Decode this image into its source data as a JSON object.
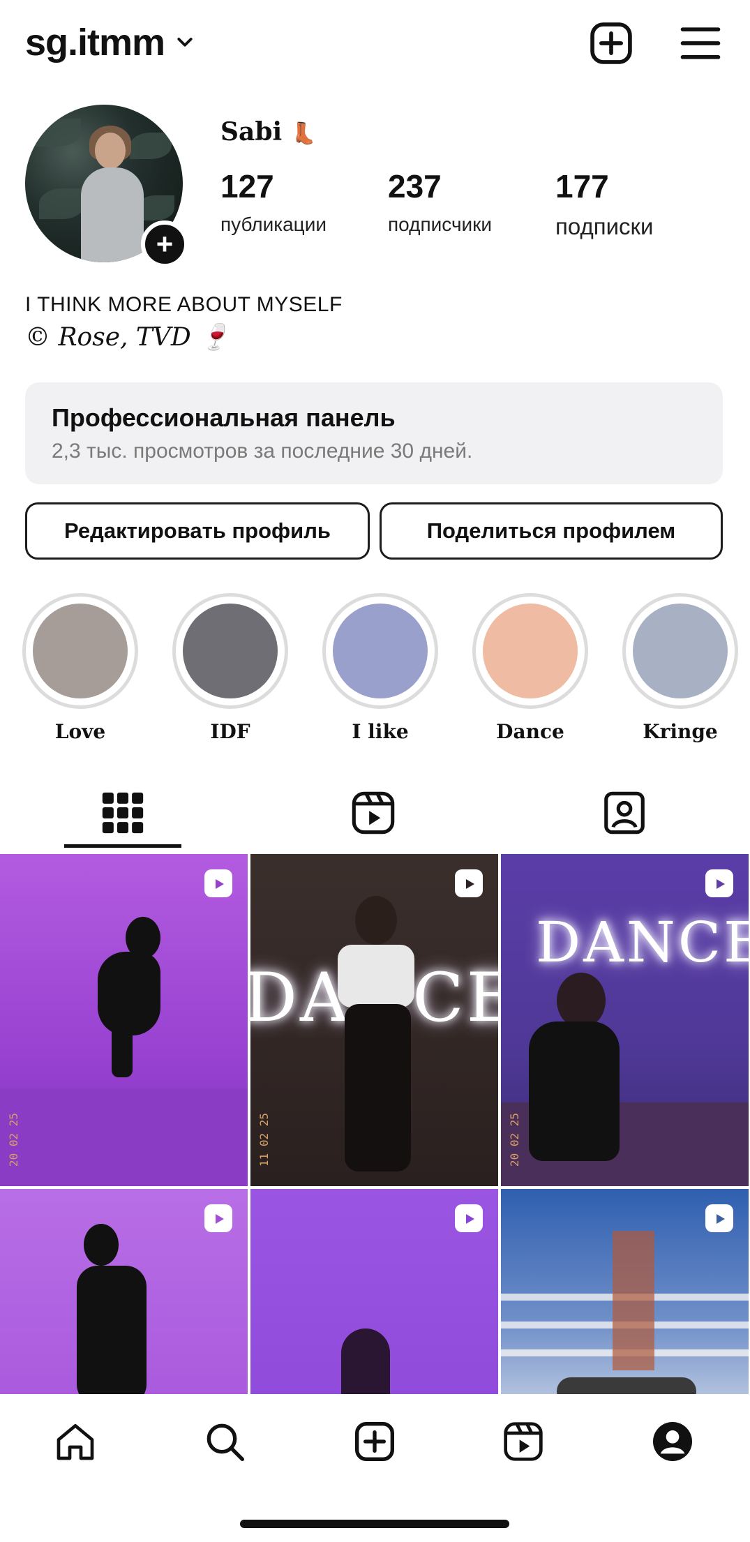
{
  "header": {
    "username": "sg.itmm",
    "icons": [
      "chevron-down-icon",
      "add-post-icon",
      "menu-icon"
    ]
  },
  "profile": {
    "display_name": "Sabi",
    "stats": [
      {
        "value": "127",
        "label": "публикации"
      },
      {
        "value": "237",
        "label": "подписчики"
      },
      {
        "value": "177",
        "label": "подписки"
      }
    ],
    "bio_line1": "I THINK MORE ABOUT MYSELF",
    "bio_line2": "© Rose, TVD 🍷"
  },
  "pro_panel": {
    "title": "Профессиональная панель",
    "subtitle": "2,3 тыс. просмотров за последние 30 дней."
  },
  "buttons": {
    "edit": "Редактировать профиль",
    "share": "Поделиться профилем"
  },
  "highlights": [
    {
      "label": "Love",
      "color": "#a69d98"
    },
    {
      "label": "IDF",
      "color": "#6e6e74"
    },
    {
      "label": "I like",
      "color": "#9aa0cc"
    },
    {
      "label": "Dance",
      "color": "#efbba3"
    },
    {
      "label": "Kringe",
      "color": "#a8b0c4"
    }
  ],
  "tabs": [
    "grid-icon",
    "reels-icon",
    "tagged-icon"
  ],
  "posts": [
    {
      "bg": "#9b46d4",
      "neon": "",
      "date": "20 02 25"
    },
    {
      "bg": "#2d2322",
      "neon": "DANCE",
      "date": "11 02 25"
    },
    {
      "bg": "#5f3fa6",
      "neon": "DANCE",
      "date": "20 02 25"
    },
    {
      "bg": "#a14fd8",
      "neon": "",
      "date": ""
    },
    {
      "bg": "#8a45d8",
      "neon": "",
      "date": ""
    },
    {
      "bg": "#3b5fa0",
      "neon": "",
      "date": ""
    }
  ],
  "nav": [
    "home-icon",
    "search-icon",
    "create-icon",
    "reels-icon",
    "profile-icon"
  ],
  "colors": {
    "accent": "#111111",
    "panel_bg": "#f1f1f3",
    "muted": "#7a7a7a"
  }
}
